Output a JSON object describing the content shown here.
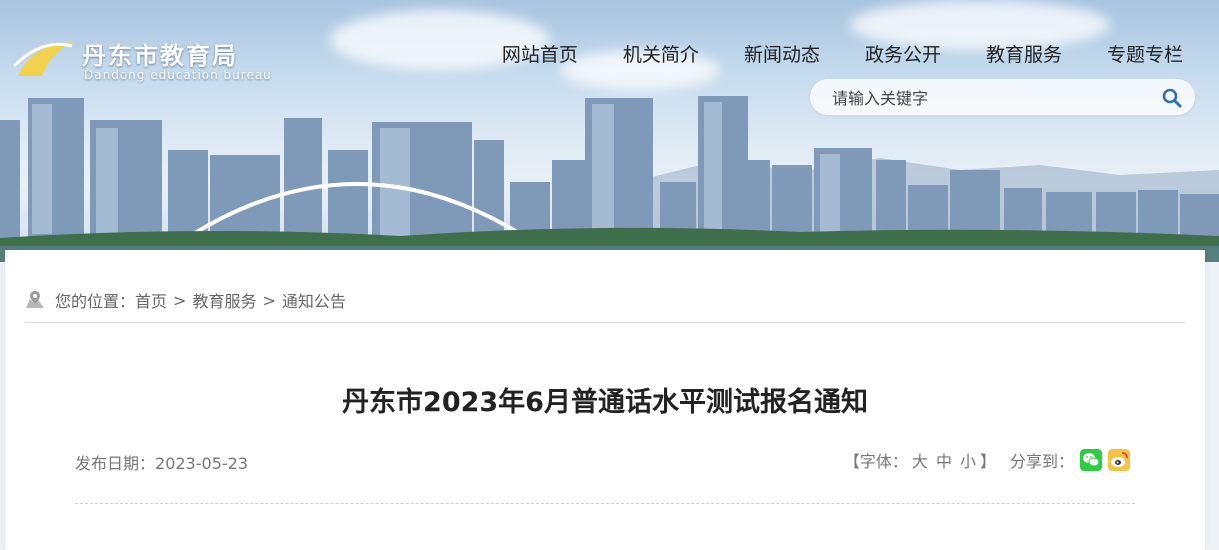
{
  "header": {
    "logo_title": "丹东市教育局",
    "logo_subtitle": "Dandong education bureau",
    "nav": [
      {
        "label": "网站首页"
      },
      {
        "label": "机关简介"
      },
      {
        "label": "新闻动态"
      },
      {
        "label": "政务公开"
      },
      {
        "label": "教育服务"
      },
      {
        "label": "专题专栏"
      }
    ],
    "search": {
      "placeholder": "请输入关键字",
      "icon": "search-icon"
    }
  },
  "breadcrumb": {
    "prefix": "您的位置：",
    "items": [
      "首页",
      "教育服务",
      "通知公告"
    ],
    "separator": ">",
    "icon": "map-location-icon"
  },
  "article": {
    "title": "丹东市2023年6月普通话水平测试报名通知",
    "date_label": "发布日期：",
    "date": "2023-05-23",
    "font_open": "【字体：",
    "font_options": [
      "大",
      "中",
      "小"
    ],
    "font_close": "】",
    "share_label": "分享到：",
    "share_icons": [
      "wechat-icon",
      "weibo-icon"
    ]
  },
  "colors": {
    "wechat": "#2ecc40",
    "weibo": "#f5c342",
    "sky": "#c7dcee"
  }
}
